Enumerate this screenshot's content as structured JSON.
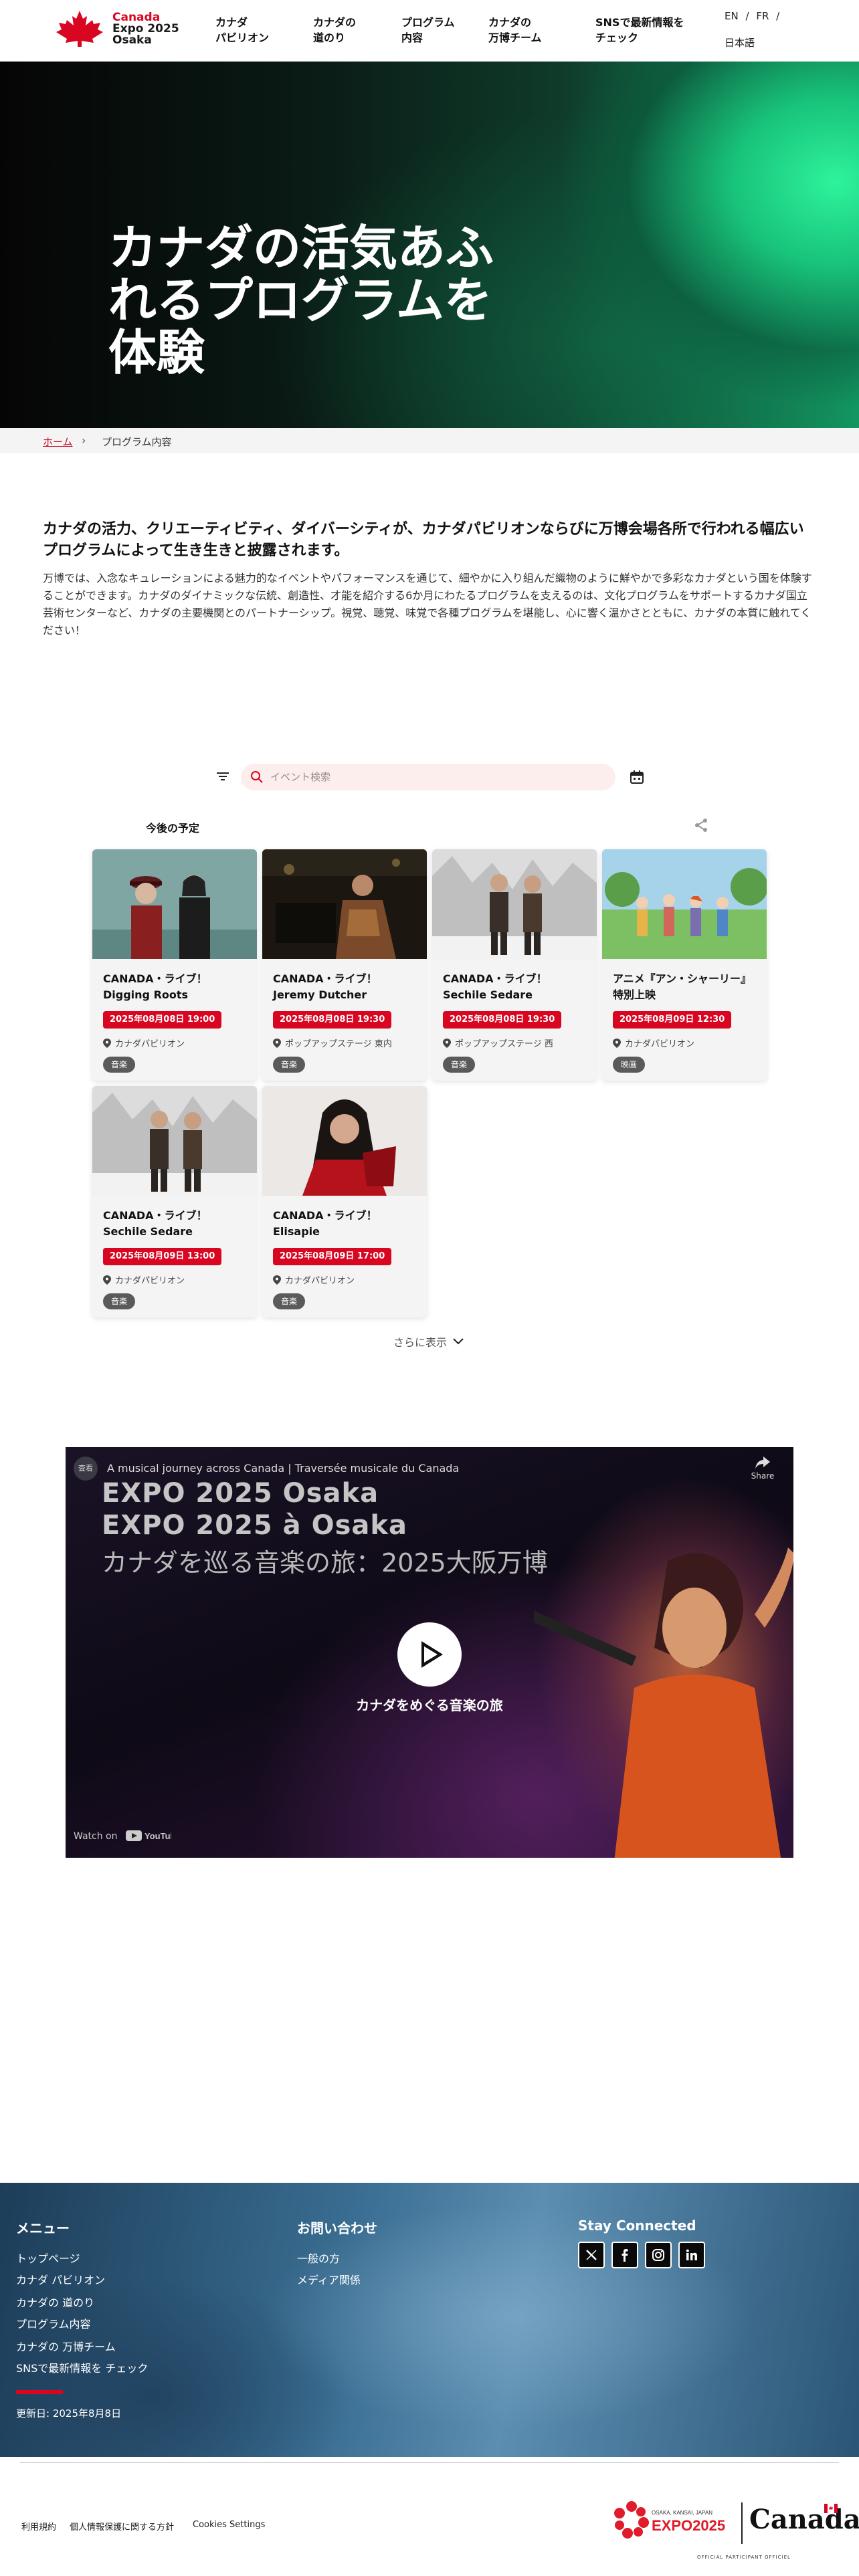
{
  "header": {
    "logo_line1": "Canada",
    "logo_line2": "Expo 2025",
    "logo_line3": "Osaka",
    "nav": [
      "カナダ\nパビリオン",
      "カナダの\n道のり",
      "プログラム\n内容",
      "カナダの\n万博チーム",
      "SNSで最新情報を\nチェック"
    ],
    "lang_en": "EN",
    "lang_fr": "FR",
    "lang_sep": "/",
    "lang_ja": "日本語"
  },
  "hero": {
    "title": "カナダの活気あふれるプログラムを体験"
  },
  "breadcrumb": {
    "home": "ホーム",
    "current": "プログラム内容"
  },
  "intro": {
    "lead": "カナダの活力、クリエーティビティ、ダイバーシティが、カナダパビリオンならびに万博会場各所で行われる幅広いプログラムによって生き生きと披露されます。",
    "body": "万博では、入念なキュレーションによる魅力的なイベントやパフォーマンスを通じて、細やかに入り組んだ織物のように鮮やかで多彩なカナダという国を体験することができます。カナダのダイナミックな伝統、創造性、才能を紹介する6か月にわたるプログラムを支えるのは、文化プログラムをサポートするカナダ国立芸術センターなど、カナダの主要機関とのパートナーシップ。視覚、聴覚、味覚で各種プログラムを堪能し、心に響く温かさとともに、カナダの本質に触れてください！"
  },
  "filters": {
    "search_placeholder": "イベント検索",
    "upcoming_label": "今後の予定"
  },
  "events": [
    {
      "title": "CANADA・ライブ！\nDigging Roots",
      "date": "2025年08月08日 19:00",
      "location": "カナダパビリオン",
      "tag": "音楽"
    },
    {
      "title": "CANADA・ライブ！\nJeremy Dutcher",
      "date": "2025年08月08日 19:30",
      "location": "ポップアップステージ 東内",
      "tag": "音楽"
    },
    {
      "title": "CANADA・ライブ！\nSechile Sedare",
      "date": "2025年08月08日 19:30",
      "location": "ポップアップステージ 西",
      "tag": "音楽"
    },
    {
      "title": "アニメ『アン・シャーリー』\n特別上映",
      "date": "2025年08月09日 12:30",
      "location": "カナダパビリオン",
      "tag": "映画"
    },
    {
      "title": "CANADA・ライブ！\nSechile Sedare",
      "date": "2025年08月09日 13:00",
      "location": "カナダパビリオン",
      "tag": "音楽"
    },
    {
      "title": "CANADA・ライブ！\nElisapie",
      "date": "2025年08月09日 17:00",
      "location": "カナダパビリオン",
      "tag": "音楽"
    }
  ],
  "more_label": "さらに表示",
  "video": {
    "channel_icon_text": "査看",
    "header_title": "A musical journey across Canada | Traversée musicale du Canada",
    "share_label": "Share",
    "line1": "EXPO 2025 Osaka",
    "line2": "EXPO 2025 à Osaka",
    "line3": "カナダを巡る音楽の旅：2025大阪万博",
    "caption": "カナダをめぐる音楽の旅",
    "watch_on": "Watch on",
    "youtube_label": "YouTube"
  },
  "footer": {
    "menu_heading": "メニュー",
    "menu_links": [
      "トップページ",
      "カナダ パビリオン",
      "カナダの 道のり",
      "プログラム内容",
      "カナダの 万博チーム",
      "SNSで最新情報を チェック"
    ],
    "contact_heading": "お問い合わせ",
    "contact_links": [
      "一般の方",
      "メディア関係"
    ],
    "social_heading": "Stay Connected",
    "social_icons": [
      "x-icon",
      "facebook-icon",
      "instagram-icon",
      "linkedin-icon"
    ],
    "updated": "更新日: 2025年8月8日",
    "bottom_links": [
      "利用規約",
      "個人情報保護に関する方針",
      "Cookies Settings"
    ],
    "expo_logo_top": "OSAKA, KANSAI, JAPAN",
    "expo_logo_main": "EXPO2025",
    "canada_wordmark": "Canada",
    "official_text": "OFFICIAL PARTICIPANT OFFICIEL"
  },
  "colors": {
    "brand_red": "#d80621",
    "hero_green": "#2ef39c",
    "footer_blue": "#3a6e92"
  }
}
